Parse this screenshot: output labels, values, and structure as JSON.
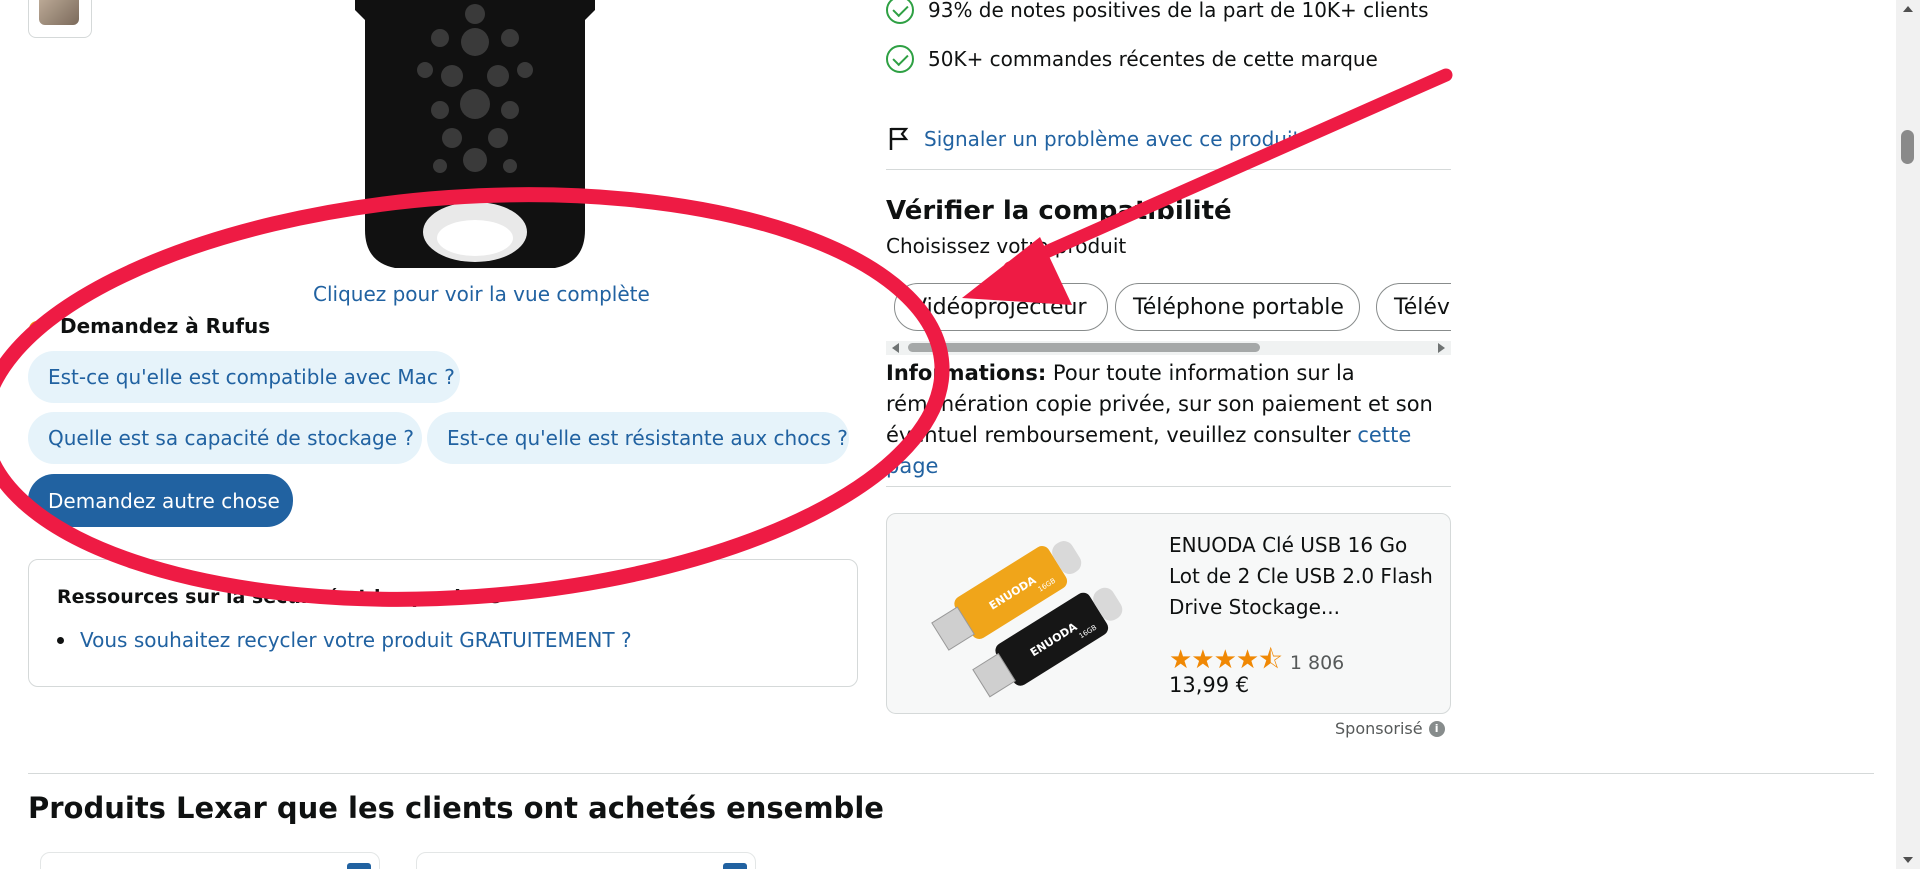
{
  "left": {
    "view_full_link": "Cliquez pour voir la vue complète",
    "rufus": {
      "title": "Demandez à Rufus",
      "questions": [
        "Est-ce qu'elle est compatible avec Mac ?",
        "Quelle est sa capacité de stockage ?",
        "Est-ce qu'elle est résistante aux chocs ?"
      ],
      "ask_other": "Demandez autre chose"
    },
    "resources": {
      "title": "Ressources sur la sécurité et les produits",
      "items": [
        "Vous souhaitez recycler votre produit GRATUITEMENT ?"
      ]
    }
  },
  "right": {
    "checks": [
      "93% de notes positives de la part de 10K+ clients",
      "50K+ commandes récentes de cette marque"
    ],
    "report_link": "Signaler un problème avec ce produit",
    "compatibility": {
      "title": "Vérifier la compatibilité",
      "subtitle": "Choisissez votre produit",
      "options": [
        "Vidéoprojecteur",
        "Téléphone portable",
        "Télév"
      ]
    },
    "info": {
      "label": "Informations:",
      "text": " Pour toute information sur la rémunération copie privée, sur son paiement et son éventuel remboursement, veuillez consulter ",
      "link": "cette page"
    },
    "sponsored_product": {
      "title": "ENUODA Clé USB 16 Go Lot de 2 Cle USB 2.0 Flash Drive Stockage...",
      "rating": 4.5,
      "stars": "★★★★⯪",
      "review_count": "1 806",
      "price": "13,99 €",
      "image_brand_text": "ENUODA",
      "image_capacity_text": "16GB"
    },
    "sponsored_label": "Sponsorisé",
    "sponsored_info_icon": "i"
  },
  "bought_together_title": "Produits Lexar que les clients ont achetés ensemble",
  "colors": {
    "link": "#2162a1",
    "chip_bg": "#e6f3fa",
    "primary_button": "#2162a1",
    "check_green": "#2ea043",
    "star_orange": "#f08804",
    "annotation_red": "#ee1b44"
  },
  "icons": [
    "check-circle-icon",
    "flag-icon",
    "rufus-icon",
    "info-icon",
    "usb-drive-image"
  ]
}
